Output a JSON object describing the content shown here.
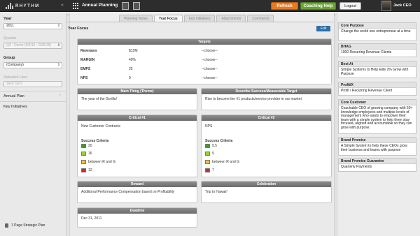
{
  "topbar": {
    "logo_text": "RHYTHM",
    "app_title": "Annual Planning",
    "refresh_label": "Refresh",
    "coaching_label": "Coaching Help",
    "logout_label": "Logout",
    "user_name": "Jack CEO",
    "colors": {
      "refresh": "#e8791f",
      "coaching": "#6aa234"
    }
  },
  "sidebar": {
    "year_label": "Year",
    "year_value": "2011",
    "quarter_label": "Quarter",
    "quarter_value": "Q3 - Demo (6/6/15 - 9/30/15)",
    "group_label": "Group",
    "group_value": "(Company)",
    "selected_user_label": "Selected User",
    "selected_user_value": "Jack CEO",
    "annual_plan_label": "Annual Plan",
    "key_initiatives_label": "Key Initiatives",
    "strategic_plan_label": "1 Page Strategic Plan"
  },
  "tabs": [
    "Planning Notes",
    "Year Focus",
    "Key Initiatives",
    "Attachments",
    "Comments"
  ],
  "active_tab": "Year Focus",
  "main": {
    "section_title": "Year Focus",
    "edit_label": "Edit",
    "targets": {
      "title": "Targets",
      "rows": [
        {
          "name": "Revenues",
          "value": "$15M",
          "choice": "--choose--"
        },
        {
          "name": "MARGIN",
          "value": "40%",
          "choice": "--choose--"
        },
        {
          "name": "EMPS",
          "value": "25",
          "choice": "--choose--"
        },
        {
          "name": "NPS",
          "value": "9",
          "choice": "--choose--"
        }
      ]
    },
    "main_thing": {
      "title": "Main Thing (Theme)",
      "text": "The year of the Gorilla!"
    },
    "success": {
      "title": "Describe Success/Measurable Target",
      "text": "Rise to become the #1 products/service provider in our market"
    },
    "critical1": {
      "title": "Critical #1",
      "name": "New Customer Contracts",
      "criteria_title": "Success Criteria",
      "criteria": [
        {
          "color": "#3d9a2b",
          "text": "20"
        },
        {
          "color": "#9ccf3b",
          "text": "16"
        },
        {
          "color": "#f2c233",
          "text": "between R and G"
        },
        {
          "color": "#d7261f",
          "text": "12"
        }
      ]
    },
    "critical2": {
      "title": "Critical #2",
      "name": "NPS",
      "criteria_title": "Success Criteria",
      "criteria": [
        {
          "color": "#3d9a2b",
          "text": "9.5"
        },
        {
          "color": "#9ccf3b",
          "text": "9"
        },
        {
          "color": "#f2c233",
          "text": "between R and G"
        },
        {
          "color": "#d7261f",
          "text": "7"
        }
      ]
    },
    "reward": {
      "title": "Reward",
      "text": "Additional Performance Compensation based on Profitability"
    },
    "celebration": {
      "title": "Celebration",
      "text": "Trip to Hawaii!"
    },
    "deadline": {
      "title": "Deadline",
      "text": "Dec 31, 2011"
    }
  },
  "right": {
    "cards": [
      {
        "title": "Core Purpose",
        "text": "Change the world one entrepreneur at a time"
      },
      {
        "title": "BHAG",
        "text": "1000 Recurring Revenue Clients"
      },
      {
        "title": "Best At",
        "text": "Simple Systems to Help Elite 2% Grow with Purpose"
      },
      {
        "title": "Profit/X",
        "text": "Profit / Recurring Revenue Client"
      },
      {
        "title": "Core Customer",
        "text": "Coachable CEO of growing company with 50+ knowledge employees and multiple levels of management who wants to empower their team with a simple system to help them stay focused, aligned and accountable so they can grow with purpose."
      },
      {
        "title": "Brand Promise",
        "text": "A Simple System to help these CEOs grow their business and teams with purpose"
      },
      {
        "title": "Brand Promise Guarantee",
        "text": "Quarterly Payments"
      }
    ]
  }
}
